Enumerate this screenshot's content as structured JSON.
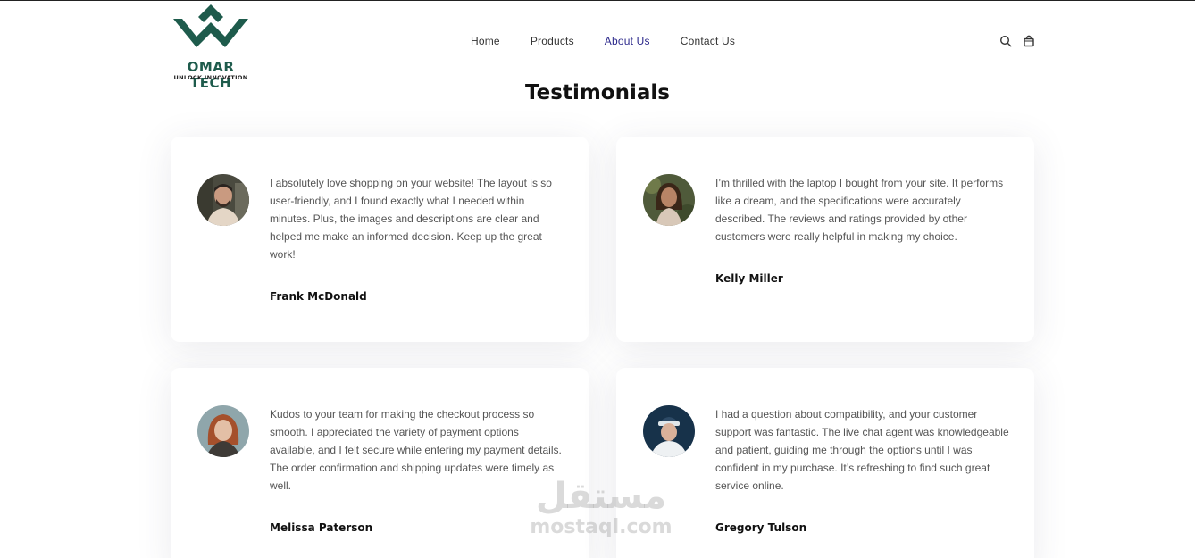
{
  "brand": {
    "name": "OMAR TECH",
    "tagline": "UNLOCK INNOVATION",
    "color": "#1e5b4c"
  },
  "nav": [
    {
      "label": "Home",
      "active": false
    },
    {
      "label": "Products",
      "active": false
    },
    {
      "label": "About Us",
      "active": true
    },
    {
      "label": "Contact Us",
      "active": false
    }
  ],
  "header_icons": [
    "search-icon",
    "shopping-bag-icon"
  ],
  "page_title": "Testimonials",
  "testimonials": [
    {
      "quote": "I absolutely love shopping on your website! The layout is so user-friendly, and I found exactly what I needed within minutes. Plus, the images and descriptions are clear and helped me make an informed decision. Keep up the great work!",
      "author": "Frank McDonald"
    },
    {
      "quote": "I’m thrilled with the laptop I bought from your site. It performs like a dream, and the specifications were accurately described. The reviews and ratings provided by other customers were really helpful in making my choice.",
      "author": "Kelly Miller"
    },
    {
      "quote": "Kudos to your team for making the checkout process so smooth. I appreciated the variety of payment options available, and I felt secure while entering my payment details. The order confirmation and shipping updates were timely as well.",
      "author": "Melissa Paterson"
    },
    {
      "quote": "I had a question about compatibility, and your customer support was fantastic. The live chat agent was knowledgeable and patient, guiding me through the options until I was confident in my purchase. It’s refreshing to find such great service online.",
      "author": "Gregory Tulson"
    }
  ],
  "watermark": {
    "arabic": "مستقل",
    "latin": "mostaql.com"
  }
}
